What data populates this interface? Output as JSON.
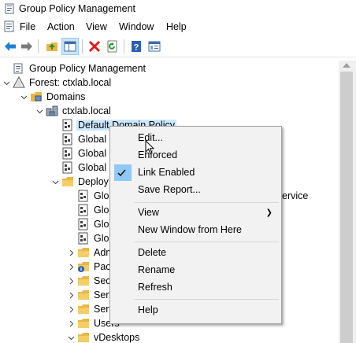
{
  "window": {
    "title": "Group Policy Management"
  },
  "menu": {
    "items": [
      "File",
      "Action",
      "View",
      "Window",
      "Help"
    ]
  },
  "toolbar": {
    "buttons": [
      "back-icon",
      "forward-icon",
      "up-folder-icon",
      "show-hide-tree-icon",
      "delete-icon",
      "refresh-icon",
      "help-icon",
      "properties-icon"
    ]
  },
  "tree": {
    "root": "Group Policy Management",
    "forest": "Forest: ctxlab.local",
    "domains": "Domains",
    "domain": "ctxlab.local",
    "default_policy": "Default Domain Policy",
    "global_1": "Global",
    "global_2": "Global",
    "global_3": "Global",
    "deploy": "Deploy",
    "glo_1": "Glo",
    "glo_2": "Glo",
    "glo_3": "Glo",
    "glo_4": "Glo",
    "glo_1_suffix": "ervice",
    "adm": "Adm",
    "pac": "Pac",
    "sec": "Sec",
    "serv_1": "Serv",
    "serv_2": "Serv",
    "users": "Users",
    "vdesktops": "vDesktops"
  },
  "context_menu": {
    "edit": "Edit...",
    "enforced": "Enforced",
    "link_enabled": "Link Enabled",
    "save_report": "Save Report...",
    "view": "View",
    "new_window": "New Window from Here",
    "delete": "Delete",
    "rename": "Rename",
    "refresh": "Refresh",
    "help": "Help"
  },
  "colors": {
    "selection": "#cce8ff",
    "toolbar_active": "#cce4f7",
    "check_bg": "#90c8f6",
    "menu_bg": "#f2f2f2",
    "folder": "#e8b64a"
  }
}
